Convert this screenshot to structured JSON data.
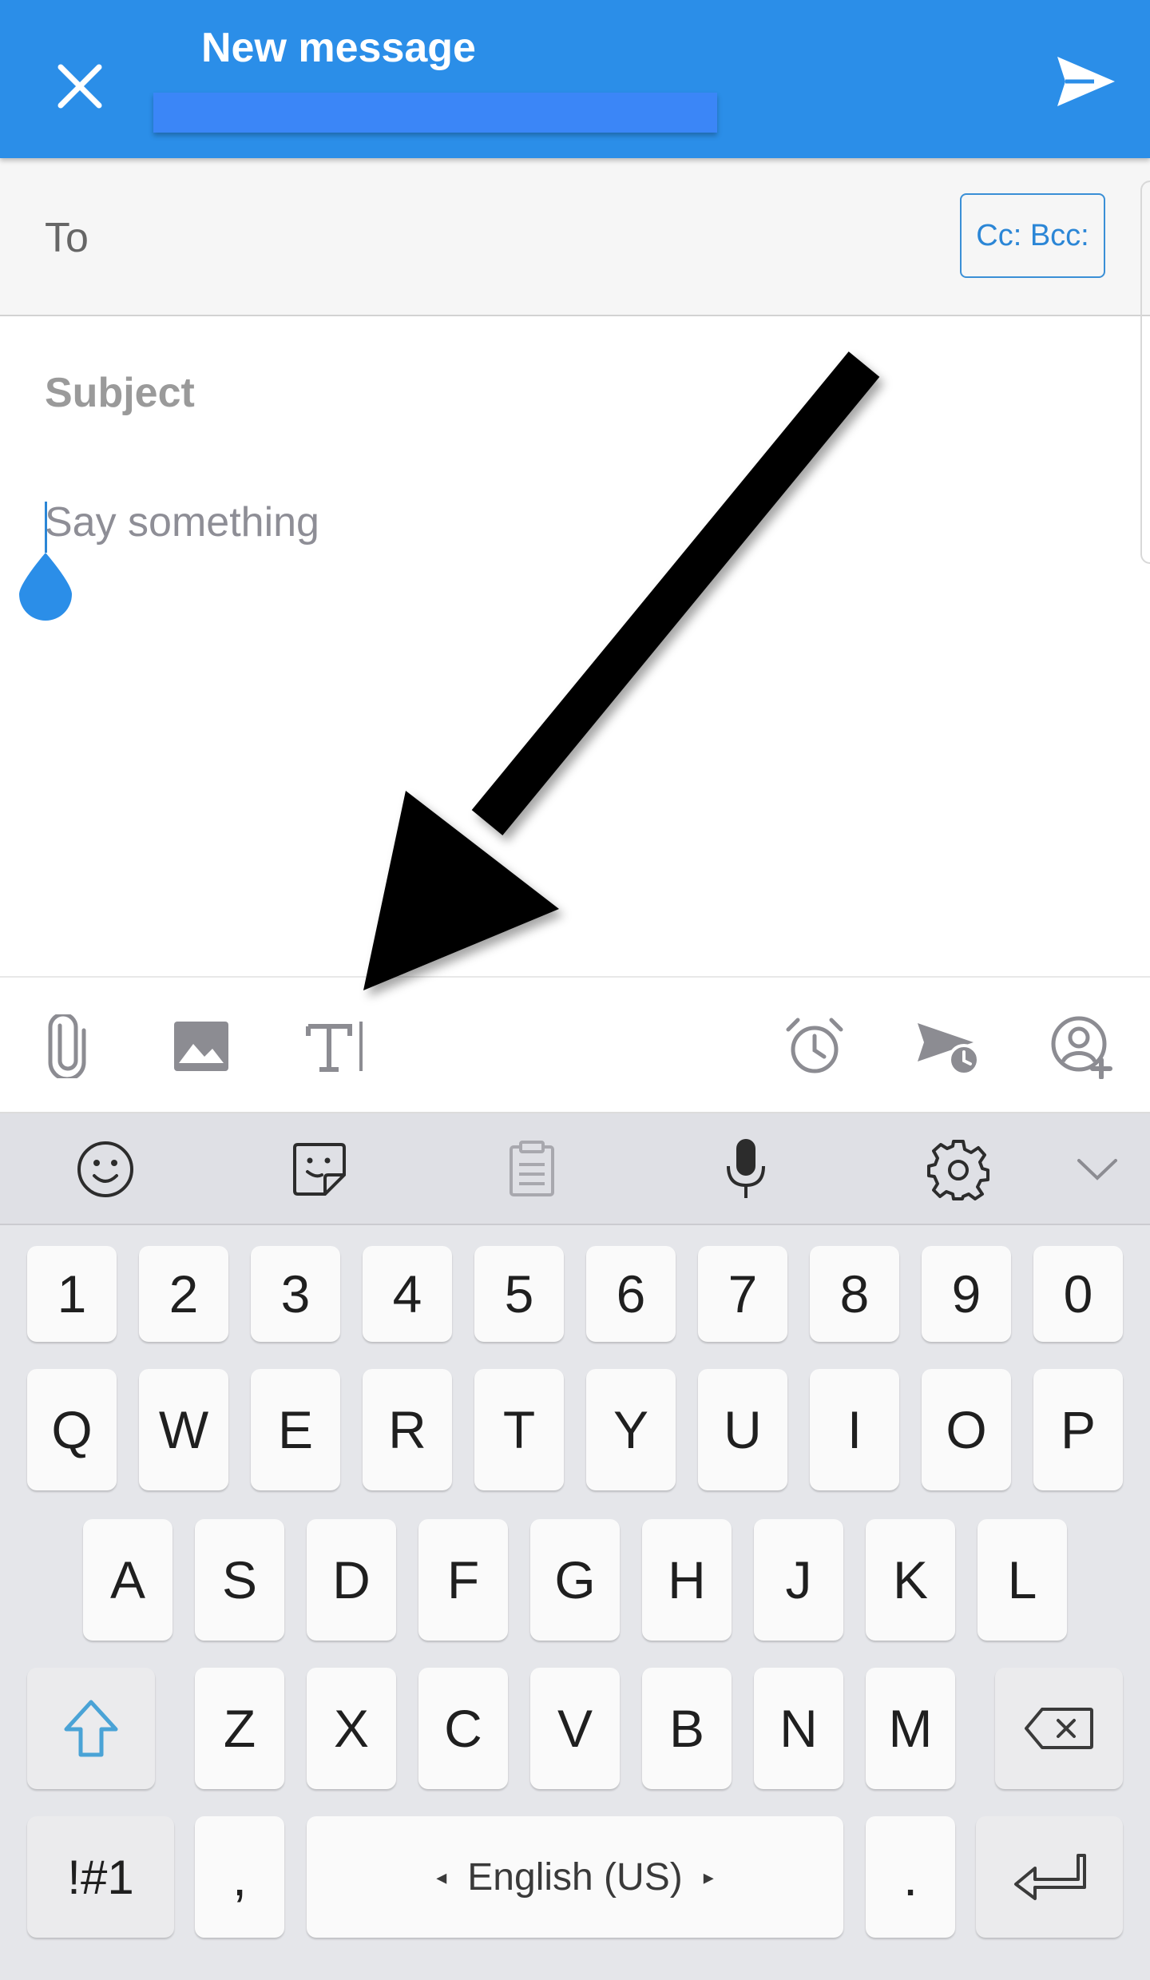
{
  "header": {
    "title": "New message",
    "color": "#2b8ee8",
    "close_icon": "close-icon",
    "send_icon": "send-icon"
  },
  "to_row": {
    "label": "To",
    "cc_bcc_label": "Cc: Bcc:"
  },
  "compose": {
    "subject_placeholder": "Subject",
    "body_placeholder": "Say something"
  },
  "toolbar": {
    "left_icons": [
      "paperclip-icon",
      "image-icon",
      "text-format-icon"
    ],
    "right_icons": [
      "alarm-clock-icon",
      "scheduled-send-icon",
      "add-contact-icon"
    ]
  },
  "keyboard": {
    "tools": [
      "emoji-icon",
      "sticker-icon",
      "clipboard-icon",
      "microphone-icon",
      "gear-icon",
      "chevron-down-icon"
    ],
    "number_row": [
      "1",
      "2",
      "3",
      "4",
      "5",
      "6",
      "7",
      "8",
      "9",
      "0"
    ],
    "row1": [
      "Q",
      "W",
      "E",
      "R",
      "T",
      "Y",
      "U",
      "I",
      "O",
      "P"
    ],
    "row2": [
      "A",
      "S",
      "D",
      "F",
      "G",
      "H",
      "J",
      "K",
      "L"
    ],
    "row3": [
      "Z",
      "X",
      "C",
      "V",
      "B",
      "N",
      "M"
    ],
    "symbols_label": "!#1",
    "comma_label": ",",
    "space_label": "English (US)",
    "period_label": ".",
    "accent_color": "#4aa3d6"
  }
}
